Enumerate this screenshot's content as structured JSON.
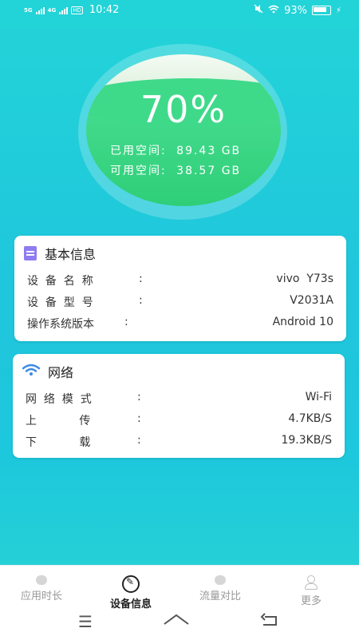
{
  "status_bar": {
    "network_1": "5G",
    "network_2": "4G",
    "hd_label": "HD",
    "time": "10:42",
    "battery_percent": "93%"
  },
  "storage": {
    "percent": "70%",
    "used_label": "已用空间:",
    "used_value": "89.43 GB",
    "free_label": "可用空间:",
    "free_value": "38.57 GB",
    "gauge_colors": {
      "fill": "#3fd98a",
      "empty": "#e6f5e5"
    }
  },
  "basic_info": {
    "title": "基本信息",
    "icon": "document-icon",
    "rows": [
      {
        "key": "设  备  名  称",
        "colon": ":",
        "value": "vivo  Y73s"
      },
      {
        "key": "设  备  型  号",
        "colon": ":",
        "value": "V2031A"
      },
      {
        "key": "操作系统版本",
        "colon": ":",
        "value": "Android 10"
      }
    ]
  },
  "network": {
    "title": "网络",
    "icon": "wifi-icon",
    "rows": [
      {
        "key": "网  络  模  式",
        "colon": ":",
        "value": "Wi-Fi"
      },
      {
        "key": "上            传",
        "colon": ":",
        "value": "4.7KB/S"
      },
      {
        "key": "下            载",
        "colon": ":",
        "value": "19.3KB/S"
      }
    ]
  },
  "bottom_nav": {
    "items": [
      {
        "label": "应用时长",
        "icon": "drop-icon",
        "active": false
      },
      {
        "label": "设备信息",
        "icon": "wrench-icon",
        "active": true
      },
      {
        "label": "流量对比",
        "icon": "drop-icon",
        "active": false
      },
      {
        "label": "更多",
        "icon": "person-icon",
        "active": false
      }
    ]
  },
  "colors": {
    "background_top": "#22d4d8",
    "background_bottom": "#2ad6d2",
    "card": "#ffffff",
    "accent_wifi": "#3b8ae6",
    "accent_doc": "#8f7cf0"
  }
}
